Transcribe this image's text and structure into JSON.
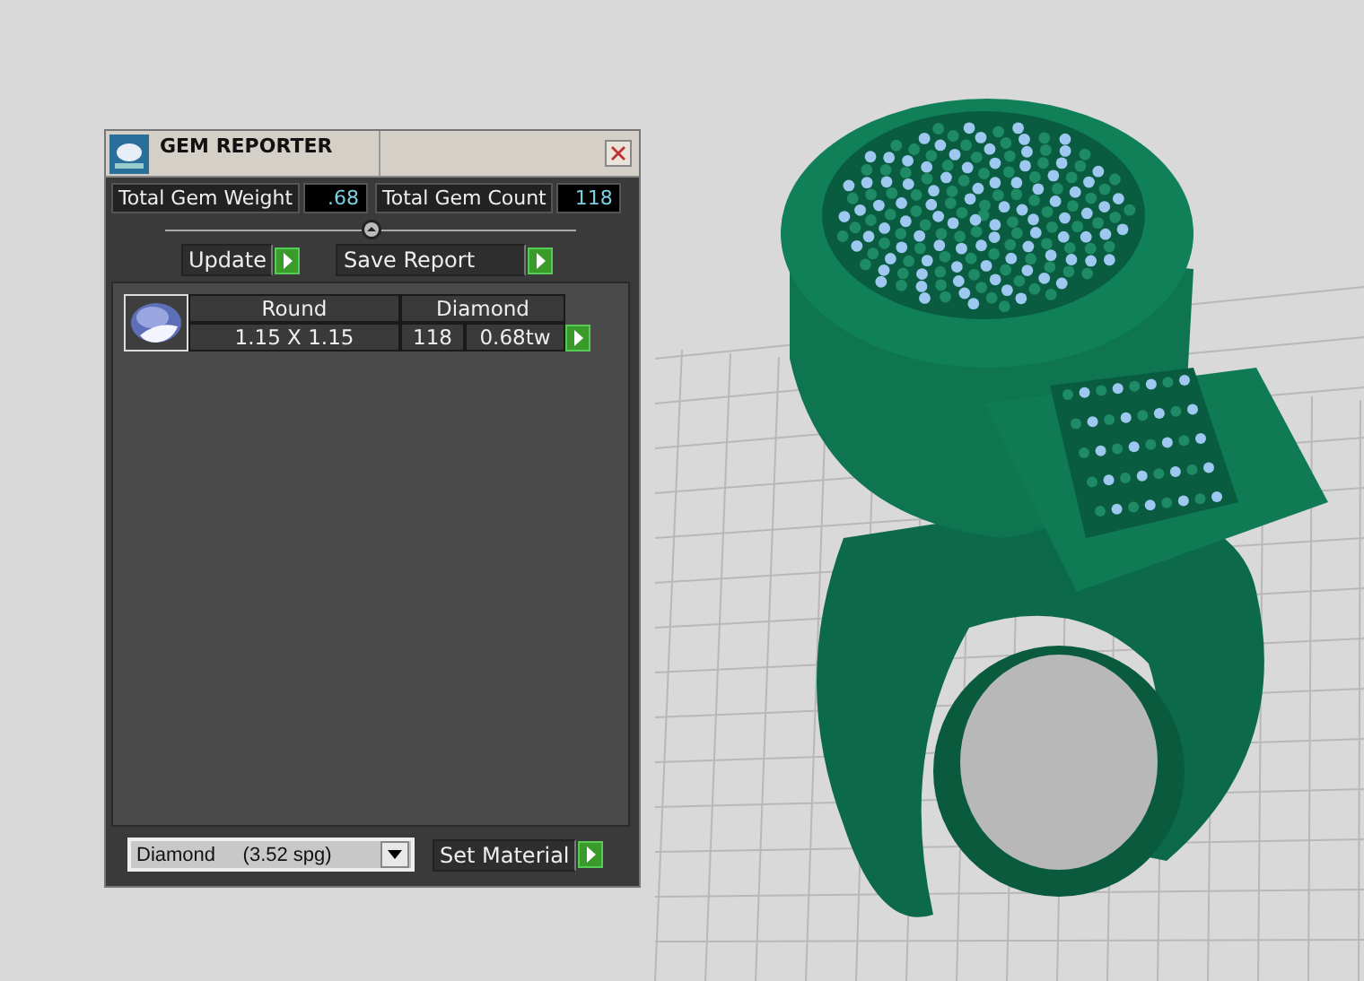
{
  "window": {
    "title": "GEM REPORTER"
  },
  "totals": [
    {
      "label": "Total Gem Weight",
      "value": ".68"
    },
    {
      "label": "Total Gem Count",
      "value": "118"
    }
  ],
  "buttons": [
    "Update",
    "Save Report"
  ],
  "gems": [
    {
      "shape": "Round",
      "material": "Diamond",
      "size": "1.15 X 1.15",
      "count": "118",
      "weight": "0.68tw"
    }
  ],
  "material_select": {
    "value": "Diamond     (3.52 spg)"
  },
  "set_material_button": "Set Material"
}
